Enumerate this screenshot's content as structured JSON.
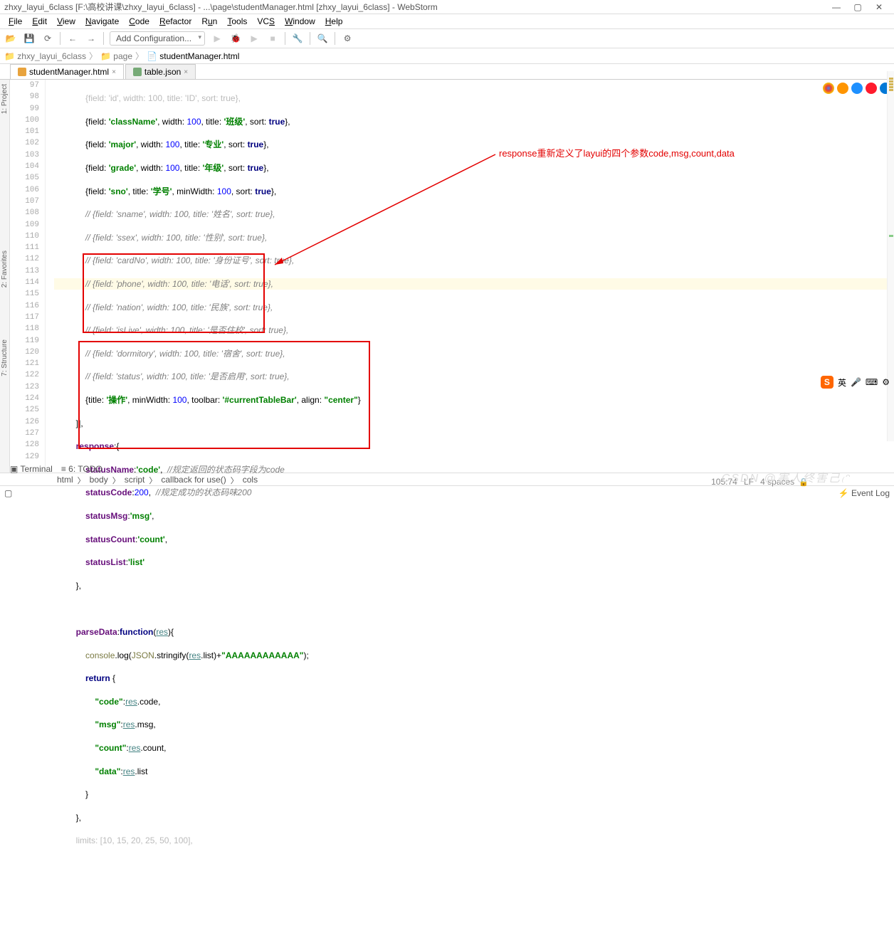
{
  "title": "zhxy_layui_6class [F:\\高校讲课\\zhxy_layui_6class] - ...\\page\\studentManager.html [zhxy_layui_6class] - WebStorm",
  "menu": {
    "file": "File",
    "edit": "Edit",
    "view": "View",
    "navigate": "Navigate",
    "code": "Code",
    "refactor": "Refactor",
    "run": "Run",
    "tools": "Tools",
    "vcs": "VCS",
    "window": "Window",
    "help": "Help"
  },
  "addconf": "Add Configuration...",
  "nav": {
    "root": "zhxy_layui_6class",
    "folder": "page",
    "file": "studentManager.html"
  },
  "tabs": {
    "t1": "studentManager.html",
    "t2": "table.json"
  },
  "sidebars": {
    "project": "1: Project",
    "favorites": "2: Favorites",
    "structure": "7: Structure"
  },
  "lines": {
    "start": 97,
    "end": 129
  },
  "code": {
    "l97": "{field: 'id', width: 100, title: 'ID', sort: true},",
    "l98": {
      "a": "{field: ",
      "b": "'className'",
      "c": ", width: ",
      "d": "100",
      "e": ", title: ",
      "f": "'班级'",
      "g": ", sort: ",
      "h": "true",
      "i": "},"
    },
    "l99": {
      "a": "{field: ",
      "b": "'major'",
      "c": ", width: ",
      "d": "100",
      "e": ", title: ",
      "f": "'专业'",
      "g": ", sort: ",
      "h": "true",
      "i": "},"
    },
    "l100": {
      "a": "{field: ",
      "b": "'grade'",
      "c": ", width: ",
      "d": "100",
      "e": ", title: ",
      "f": "'年级'",
      "g": ", sort: ",
      "h": "true",
      "i": "},"
    },
    "l101": {
      "a": "{field: ",
      "b": "'sno'",
      "c": ", title: ",
      "d": "'学号'",
      "e": ", minWidth: ",
      "f": "100",
      "g": ", sort: ",
      "h": "true",
      "i": "},"
    },
    "l102": "// {field: 'sname', width: 100, title: '姓名', sort: true},",
    "l103": "// {field: 'ssex', width: 100, title: '性别', sort: true},",
    "l104": "// {field: 'cardNo', width: 100, title: '身份证号', sort: true},",
    "l105": "// {field: 'phone', width: 100, title: '电话', sort: true},",
    "l106": "// {field: 'nation', width: 100, title: '民族', sort: true},",
    "l107": "// {field: 'isLive', width: 100, title: '是否住校', sort: true},",
    "l108": "// {field: 'dormitory', width: 100, title: '宿舍', sort: true},",
    "l109": "// {field: 'status', width: 100, title: '是否启用', sort: true},",
    "l110": {
      "a": "{title: ",
      "b": "'操作'",
      "c": ", minWidth: ",
      "d": "100",
      "e": ", toolbar: ",
      "f": "'#currentTableBar'",
      "g": ", align: ",
      "h": "\"center\"",
      "i": "}"
    },
    "l111": "]],",
    "l112": "response:{",
    "l113": {
      "a": "statusName:",
      "b": "'code'",
      "c": ",  ",
      "d": "//规定返回的状态码字段为code"
    },
    "l114": {
      "a": "statusCode:",
      "b": "200",
      "c": ",  ",
      "d": "//规定成功的状态码味200"
    },
    "l115": {
      "a": "statusMsg:",
      "b": "'msg'",
      "c": ","
    },
    "l116": {
      "a": "statusCount:",
      "b": "'count'",
      "c": ","
    },
    "l117": {
      "a": "statusList:",
      "b": "'list'"
    },
    "l118": "},",
    "l120": {
      "a": "parseData:",
      "b": "function",
      "c": "(",
      "d": "res",
      "e": "){"
    },
    "l121": {
      "a": "console",
      "b": ".log(",
      "c": "JSON",
      "d": ".stringify(",
      "e": "res",
      "f": ".list)+",
      "g": "\"AAAAAAAAAAAA\"",
      "h": ");"
    },
    "l122": {
      "a": "return ",
      "b": "{"
    },
    "l123": {
      "a": "\"code\"",
      "b": ":",
      "c": "res",
      "d": ".code,"
    },
    "l124": {
      "a": "\"msg\"",
      "b": ":",
      "c": "res",
      "d": ".msg,"
    },
    "l125": {
      "a": "\"count\"",
      "b": ":",
      "c": "res",
      "d": ".count,"
    },
    "l126": {
      "a": "\"data\"",
      "b": ":",
      "c": "res",
      "d": ".list"
    },
    "l127": "}",
    "l128": "},",
    "l129": "limits: [10, 15, 20, 25, 50, 100],"
  },
  "annotation": "response重新定义了layui的四个参数code,msg,count,data",
  "breadcrumb": {
    "a": "html",
    "b": "body",
    "c": "script",
    "d": "callback for use()",
    "e": "cols"
  },
  "bottom": {
    "terminal": "Terminal",
    "todo": "6: TODO",
    "eventlog": "Event Log"
  },
  "status": {
    "pos": "105:74",
    "enc": "LF",
    "sp": "4 spaces"
  },
  "ime": "英"
}
